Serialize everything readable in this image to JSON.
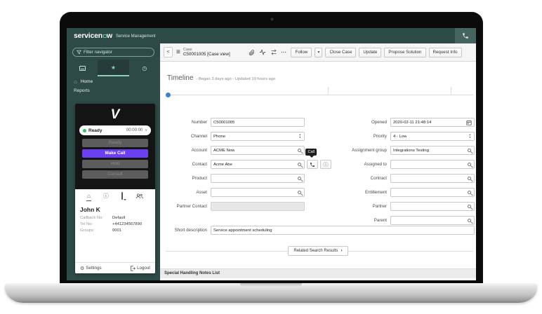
{
  "app": {
    "header": {
      "brand_pre": "servicen",
      "brand_post": "w",
      "suffix": "Service Management"
    },
    "sidebar": {
      "filter_placeholder": "Filter navigator",
      "items": [
        {
          "label": "Home"
        },
        {
          "label": "Reports"
        }
      ]
    },
    "case_header": {
      "record_type": "Case",
      "record_id": "C50001005 [Case view]",
      "actions": [
        {
          "label": "Follow"
        },
        {
          "label": "Close Case"
        },
        {
          "label": "Update"
        },
        {
          "label": "Propose Solution"
        },
        {
          "label": "Request Info"
        }
      ]
    },
    "timeline": {
      "title": "Timeline",
      "subtitle": "- Began 3 days ago - Updated 19 hours ago"
    },
    "form": {
      "left": [
        {
          "label": "Number",
          "value": "C50001005"
        },
        {
          "label": "Channel",
          "value": "Phone"
        },
        {
          "label": "Account",
          "value": "ACME Now"
        },
        {
          "label": "Contact",
          "value": "Acme Abe"
        },
        {
          "label": "Product",
          "value": ""
        },
        {
          "label": "Asset",
          "value": ""
        },
        {
          "label": "Partner Contact",
          "value": ""
        }
      ],
      "right": [
        {
          "label": "Opened",
          "value": "2020-02-11 21:48:14"
        },
        {
          "label": "Priority",
          "value": "4 - Low"
        },
        {
          "label": "Assignment group",
          "value": "Integrations Testing"
        },
        {
          "label": "Assigned to",
          "value": ""
        },
        {
          "label": "Contract",
          "value": ""
        },
        {
          "label": "Entitlement",
          "value": ""
        },
        {
          "label": "Partner",
          "value": ""
        },
        {
          "label": "Parent",
          "value": ""
        }
      ],
      "short_description": {
        "label": "Short description",
        "value": "Service appointment scheduling"
      },
      "call_tooltip": "Call"
    },
    "related_search": {
      "label": "Related Search Results",
      "chevron": "›"
    },
    "bottom_bar": {
      "label": "Special Handling Notes List"
    }
  },
  "phone_widget": {
    "logo": "V",
    "status": {
      "label": "Ready",
      "timer": "00:00:00",
      "chevron": "∨"
    },
    "buttons": [
      {
        "label": "Ready"
      },
      {
        "label": "Make Call"
      },
      {
        "label": "Hold"
      },
      {
        "label": "Consult"
      }
    ],
    "contact": {
      "name": "John K",
      "rows": [
        {
          "label": "Callback No:",
          "value": "Default"
        },
        {
          "label": "Tel No:",
          "value": "+441234567890"
        },
        {
          "label": "Groups:",
          "value": "0001"
        }
      ]
    },
    "footer": {
      "settings": "Settings",
      "logout": "Logout"
    }
  },
  "icons": {
    "star": "★",
    "clock": "◷",
    "home": "⌂",
    "gear": "⚙",
    "info": "ⓘ",
    "back": "<",
    "burger": "≡",
    "more": "•••",
    "caret_down": "▾"
  },
  "colors": {
    "teal_header": "#2e4a47",
    "mint_accent": "#8fd0b4",
    "purple_primary": "#6c3ff2",
    "timeline_dot": "#3e82c8",
    "status_green": "#35c26e"
  }
}
